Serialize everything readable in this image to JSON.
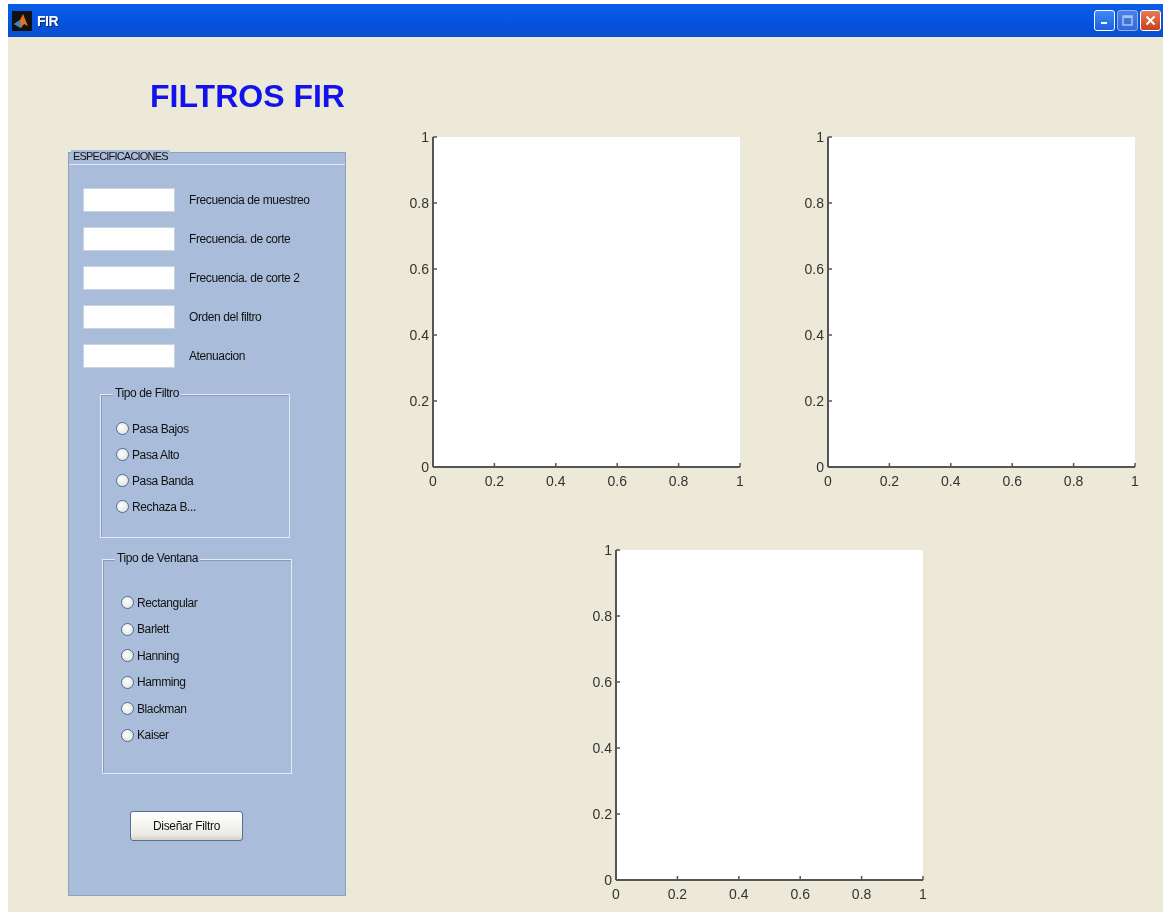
{
  "window": {
    "title": "FIR"
  },
  "heading": "FILTROS FIR",
  "specifications": {
    "title": "ESPECIFICACIONES",
    "fields": [
      {
        "label": "Frecuencia de muestreo"
      },
      {
        "label": "Frecuencia. de corte"
      },
      {
        "label": "Frecuencia. de corte 2"
      },
      {
        "label": "Orden del filtro"
      },
      {
        "label": "Atenuacion"
      }
    ],
    "filter_type": {
      "title": "Tipo de Filtro",
      "options": [
        {
          "label": "Pasa Bajos",
          "selected": false
        },
        {
          "label": "Pasa Alto",
          "selected": false
        },
        {
          "label": "Pasa Banda",
          "selected": false
        },
        {
          "label": "Rechaza B...",
          "selected": false
        }
      ]
    },
    "window_type": {
      "title": "Tipo de Ventana",
      "options": [
        {
          "label": "Rectangular",
          "selected": false
        },
        {
          "label": "Barlett",
          "selected": false
        },
        {
          "label": "Hanning",
          "selected": false
        },
        {
          "label": "Hamming",
          "selected": false
        },
        {
          "label": "Blackman",
          "selected": false
        },
        {
          "label": "Kaiser",
          "selected": false
        }
      ]
    },
    "button": "Diseñar Filtro"
  },
  "plots": [
    {
      "chart_data": {
        "type": "line",
        "xlim": [
          0,
          1
        ],
        "ylim": [
          0,
          1
        ],
        "xticks": [
          0,
          0.2,
          0.4,
          0.6,
          0.8,
          1
        ],
        "yticks": [
          0,
          0.2,
          0.4,
          0.6,
          0.8,
          1
        ]
      }
    },
    {
      "chart_data": {
        "type": "line",
        "xlim": [
          0,
          1
        ],
        "ylim": [
          0,
          1
        ],
        "xticks": [
          0,
          0.2,
          0.4,
          0.6,
          0.8,
          1
        ],
        "yticks": [
          0,
          0.2,
          0.4,
          0.6,
          0.8,
          1
        ]
      }
    },
    {
      "chart_data": {
        "type": "line",
        "xlim": [
          0,
          1
        ],
        "ylim": [
          0,
          1
        ],
        "xticks": [
          0,
          0.2,
          0.4,
          0.6,
          0.8,
          1
        ],
        "yticks": [
          0,
          0.2,
          0.4,
          0.6,
          0.8,
          1
        ]
      }
    }
  ]
}
